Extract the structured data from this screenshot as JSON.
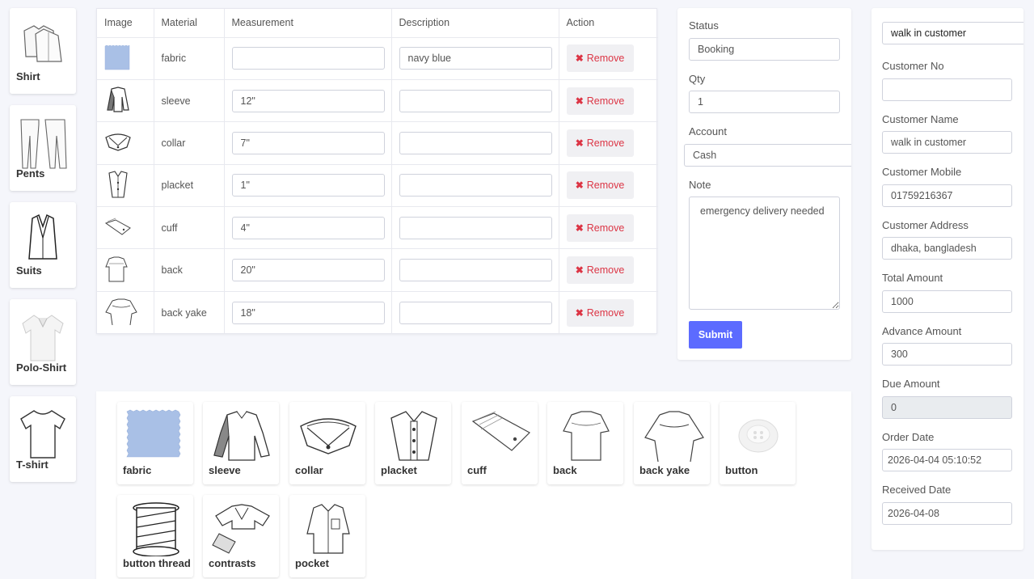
{
  "categories": [
    "Shirt",
    "Pents",
    "Suits",
    "Polo-Shirt",
    "T-shirt"
  ],
  "table": {
    "headers": [
      "Image",
      "Material",
      "Measurement",
      "Description",
      "Action"
    ],
    "remove_label": "Remove",
    "rows": [
      {
        "material": "fabric",
        "measurement": "",
        "description": "navy blue"
      },
      {
        "material": "sleeve",
        "measurement": "12\"",
        "description": ""
      },
      {
        "material": "collar",
        "measurement": "7\"",
        "description": ""
      },
      {
        "material": "placket",
        "measurement": "1\"",
        "description": ""
      },
      {
        "material": "cuff",
        "measurement": "4\"",
        "description": ""
      },
      {
        "material": "back",
        "measurement": "20\"",
        "description": ""
      },
      {
        "material": "back yake",
        "measurement": "18\"",
        "description": ""
      }
    ]
  },
  "order": {
    "status_label": "Status",
    "status_value": "Booking",
    "qty_label": "Qty",
    "qty_value": "1",
    "account_label": "Account",
    "account_value": "Cash",
    "note_label": "Note",
    "note_value": "emergency delivery needed",
    "submit_label": "Submit"
  },
  "customer": {
    "type_value": "walk in customer",
    "no_label": "Customer No",
    "no_value": "",
    "name_label": "Customer Name",
    "name_value": "walk in customer",
    "mobile_label": "Customer Mobile",
    "mobile_value": "01759216367",
    "address_label": "Customer Address",
    "address_value": "dhaka, bangladesh",
    "total_label": "Total Amount",
    "total_value": "1000",
    "advance_label": "Advance Amount",
    "advance_value": "300",
    "due_label": "Due Amount",
    "due_value": "0",
    "order_date_label": "Order Date",
    "order_date_value": "2026-04-04 05:10:52",
    "received_date_label": "Received Date",
    "received_date_value": "2026-04-08"
  },
  "parts": [
    "fabric",
    "sleeve",
    "collar",
    "placket",
    "cuff",
    "back",
    "back yake",
    "button",
    "button thread",
    "contrasts",
    "pocket"
  ],
  "colors": {
    "accent": "#5c6bff",
    "danger": "#dc3545",
    "fabric": "#a9c0e6"
  }
}
